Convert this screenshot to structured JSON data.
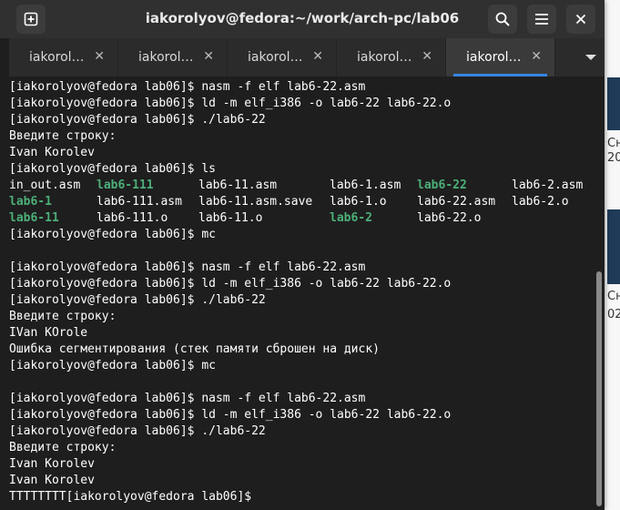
{
  "window": {
    "title": "iakorolyov@fedora:~/work/arch-pc/lab06"
  },
  "tabs": [
    {
      "label": "iakorol…",
      "active": false
    },
    {
      "label": "iakorol…",
      "active": false
    },
    {
      "label": "iakorol…",
      "active": false
    },
    {
      "label": "iakorol…",
      "active": false
    },
    {
      "label": "iakorol…",
      "active": true
    }
  ],
  "terminal": {
    "lines_before_ls": [
      "[iakorolyov@fedora lab06]$ nasm -f elf lab6-22.asm",
      "[iakorolyov@fedora lab06]$ ld -m elf_i386 -o lab6-22 lab6-22.o",
      "[iakorolyov@fedora lab06]$ ./lab6-22",
      "Введите строку:",
      "Ivan Korolev",
      "[iakorolyov@fedora lab06]$ ls"
    ],
    "ls_rows": [
      [
        "in_out.asm",
        "lab6-111",
        "lab6-11.asm",
        "lab6-1.asm",
        "lab6-22",
        "lab6-2.asm"
      ],
      [
        "lab6-1",
        "lab6-111.asm",
        "lab6-11.asm.save",
        "lab6-1.o",
        "lab6-22.asm",
        "lab6-2.o"
      ],
      [
        "lab6-11",
        "lab6-111.o",
        "lab6-11.o",
        "lab6-2",
        "lab6-22.o",
        ""
      ]
    ],
    "ls_executable": [
      [
        false,
        true,
        false,
        false,
        true,
        false
      ],
      [
        true,
        false,
        false,
        false,
        false,
        false
      ],
      [
        true,
        false,
        false,
        true,
        false,
        false
      ]
    ],
    "lines_after_ls": [
      "[iakorolyov@fedora lab06]$ mc",
      "",
      "[iakorolyov@fedora lab06]$ nasm -f elf lab6-22.asm",
      "[iakorolyov@fedora lab06]$ ld -m elf_i386 -o lab6-22 lab6-22.o",
      "[iakorolyov@fedora lab06]$ ./lab6-22",
      "Введите строку:",
      "IVan KOrole",
      "Ошибка сегментирования (стек памяти сброшен на диск)",
      "[iakorolyov@fedora lab06]$ mc",
      "",
      "[iakorolyov@fedora lab06]$ nasm -f elf lab6-22.asm",
      "[iakorolyov@fedora lab06]$ ld -m elf_i386 -o lab6-22 lab6-22.o",
      "[iakorolyov@fedora lab06]$ ./lab6-22",
      "Введите строку:",
      "Ivan Korolev",
      "Ivan Korolev",
      "TTTTTTTT[iakorolyov@fedora lab06]$"
    ]
  },
  "background": {
    "right_text": [
      "Сн",
      "20",
      "Сн",
      "02"
    ]
  },
  "colors": {
    "terminal_bg": "#1e1e1e",
    "executable": "#4caf79",
    "tab_accent": "#3584e4"
  }
}
